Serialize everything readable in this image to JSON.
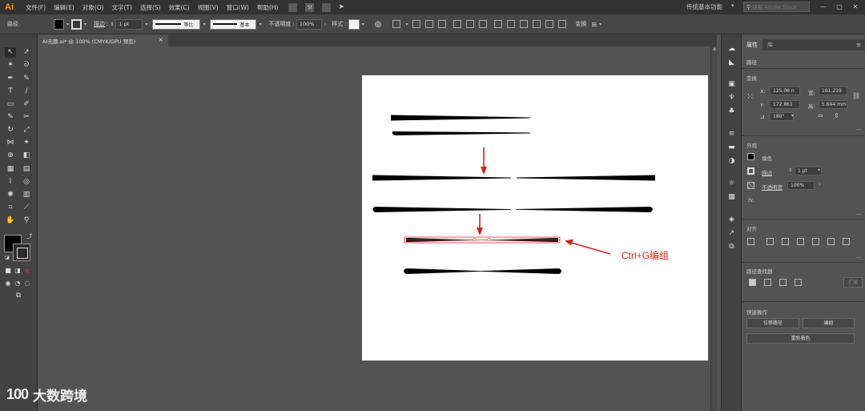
{
  "app": {
    "logo": "Ai"
  },
  "menubar": {
    "items": [
      "文件(F)",
      "编辑(E)",
      "对象(O)",
      "文字(T)",
      "选择(S)",
      "效果(C)",
      "视图(V)",
      "窗口(W)",
      "帮助(H)"
    ],
    "st_label": "St",
    "workspace": "传统基本功能",
    "search_placeholder": "搜索 Adobe Stock"
  },
  "controlbar": {
    "selection_label": "路径",
    "stroke_label": "描边",
    "stroke_weight": "1 pt",
    "profile_label": "等比",
    "brush_label": "基本",
    "opacity_label": "不透明度",
    "opacity_value": "100%",
    "style_label": "样式",
    "transform_label": "变换"
  },
  "document": {
    "tab_title": "AI无题.ai* @ 100% (CMYK/GPU 预览)"
  },
  "canvas": {
    "annotation": "Ctrl+G编组",
    "accent_color": "#d6241a"
  },
  "panel": {
    "tabs": [
      "属性",
      "库"
    ],
    "selection_label": "路径",
    "transform_title": "变换",
    "x_label": "X:",
    "x_value": "125.06 n",
    "y_label": "Y:",
    "y_value": "172.861",
    "w_label": "宽:",
    "w_value": "161.219",
    "h_label": "高:",
    "h_value": "5.644 mm",
    "angle_value": "180°",
    "appearance_title": "外观",
    "fill_label": "填色",
    "stroke_label": "描边",
    "stroke_value": "1 pt",
    "opacity_label": "不透明度",
    "opacity_value": "100%",
    "fx_label": "fx.",
    "align_title": "对齐",
    "pathfinder_title": "路径查找器",
    "pathfinder_expand": "扩展",
    "quick_actions_title": "快速操作",
    "offset_path_btn": "位移路径",
    "group_btn": "编组",
    "recolor_btn": "重新着色"
  },
  "watermark": {
    "logo": "100",
    "text": "大数跨境"
  }
}
